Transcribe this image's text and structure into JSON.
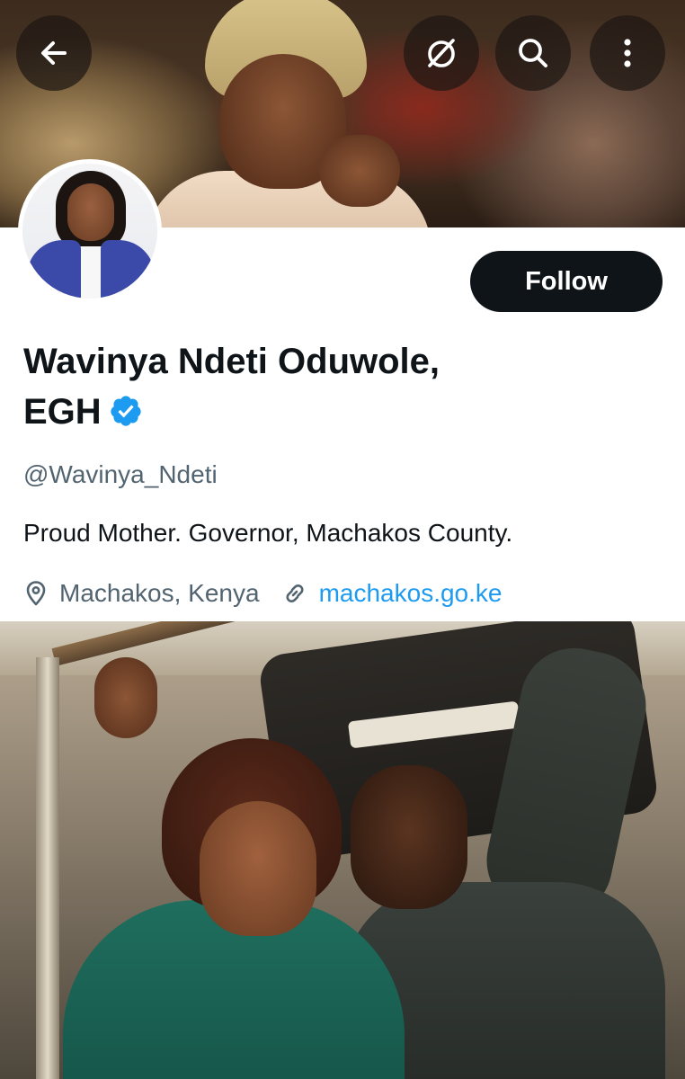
{
  "header": {
    "back_icon": "arrow-left-icon",
    "grok_icon": "grok-icon",
    "search_icon": "search-icon",
    "more_icon": "more-vertical-icon"
  },
  "profile": {
    "name_line1": "Wavinya Ndeti Oduwole,",
    "name_line2": "EGH",
    "verified_icon": "verified-badge-icon",
    "handle": "@Wavinya_Ndeti",
    "bio": "Proud Mother. Governor, Machakos County.",
    "location": "Machakos, Kenya",
    "location_icon": "location-pin-icon",
    "website": "machakos.go.ke",
    "website_icon": "link-icon",
    "follow_label": "Follow"
  },
  "colors": {
    "text_primary": "#0f1419",
    "text_secondary": "#536471",
    "link": "#1d9bf0",
    "verified": "#1d9bf0",
    "follow_bg": "#0f1419"
  }
}
